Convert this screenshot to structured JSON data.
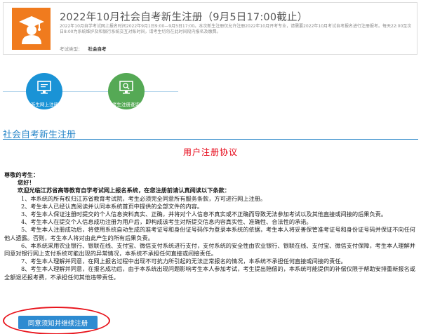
{
  "header": {
    "title": "2022年10月社会自考新生注册（9月5日17:00截止）",
    "description": "2022年10月自学考试网上报名时间2022年9月1日9:00—9月5日17:00。本次新生注册仅允许注册2022年10月开考专业，请需要2022年10月考试自考报名进行注册报考。每天22:00至次日8:00为系统维护及和银行系统交互对账时间，请考生切勿在此时间段内报名及缴费。",
    "type_label": "考试类型：",
    "type_value": "社会自考",
    "icon": "graduate-cap-icon",
    "accent_color": "#f07b1e"
  },
  "steps": [
    {
      "label": "新生网上注册",
      "icon": "monitor-icon",
      "color": "#1a93d6"
    },
    {
      "label": "考生注册查询",
      "icon": "search-monitor-icon",
      "color": "#55a955"
    }
  ],
  "section": {
    "title": "社会自考新生注册",
    "color": "#2786c8"
  },
  "agreement": {
    "title": "用户注册协议",
    "greeting": "尊敬的考生：",
    "hello": "您好！",
    "welcome": "欢迎光临江苏省高等教育自学考试网上报名系统，在您注册前请认真阅读以下条款：",
    "items": [
      "1、本系统的所有权归江苏省教育考试院，考生必须完全同意所有服务条款，方可进行网上注册。",
      "2、考生本人已经认真阅读并认同本系统首页中提供的全部文件的内容。",
      "3、考生本人保证注册时提交的个人信息资料真实、正确，并将对个人信息不真实或不正确而导致无法参加考试以及其他直接或间接的后果负责。",
      "4、考生本人在提交个人信息成功注册为用户后，即构成该考生对所提交信息内容真实性、准确性、合法性的承诺。",
      "5、考生本人注册成功后，将使用系统自动生成的准考证号和身份证号码作为登录本系统的依据，考生本人将妥善保管准考证号和身份证号码并保证不向任何他人透露。否则，考生本人将对由此产生的所有后果负责。",
      "6、本系统采用农业银行、银联在线、支付宝、微信支付系统进行支付，支付系统的安全性由农业银行、银联在线、支付宝、微信支付保障，考生本人理解并同意对银行网上支付系统可能出现的异常情况，本系统不承担任何直接或间接责任。",
      "7、考生本人理解并同意，在网上报名过程中出现不可抗力所引起的无法正常报名的情况，本系统不承担任何直接或间接的责任。",
      "8、考生本人理解并同意，在报名成功后，由于本系统出现问题影响考生本人参加考试，考生提出赔偿的，本系统可能提供的补偿仅限于帮助安排重新报名或全额退还报考费，不承担任何其他违带责任。"
    ],
    "title_color": "#e60012"
  },
  "agree_button": {
    "label": "同意须知并继续注册",
    "color": "#2e8bd1"
  },
  "annotation": {
    "shape": "ellipse",
    "color": "#e8141c"
  }
}
